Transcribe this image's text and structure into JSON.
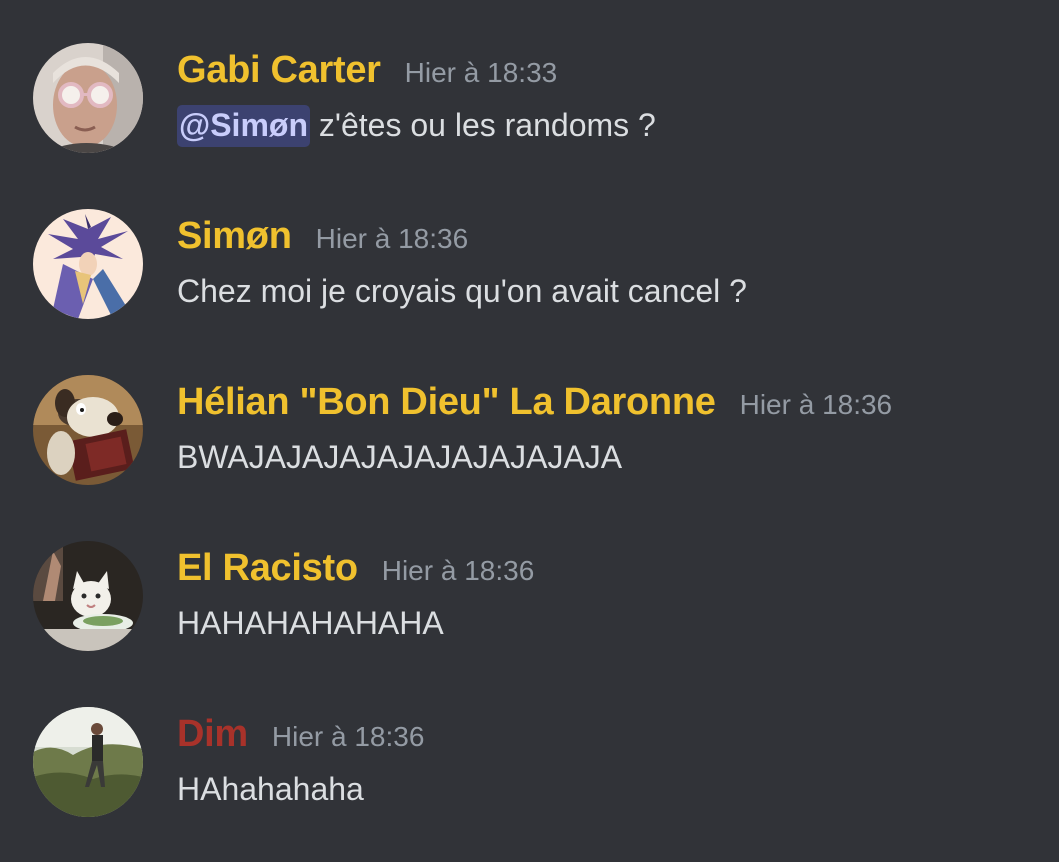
{
  "colors": {
    "background": "#313338",
    "author_gold": "#f0c12e",
    "author_red": "#a8322a",
    "timestamp": "#949ba4",
    "text": "#dbdee1",
    "mention_bg": "#3c4270",
    "mention_text": "#c9cdfb"
  },
  "messages": [
    {
      "author": "Gabi Carter",
      "author_color": "#f0c12e",
      "timestamp": "Hier à 18:33",
      "mention": "@Simøn",
      "text": " z'êtes ou les randoms ?",
      "avatar": "man-with-glasses-avatar"
    },
    {
      "author": "Simøn",
      "author_color": "#f0c12e",
      "timestamp": "Hier à 18:36",
      "text": "Chez moi je croyais qu'on avait cancel ?",
      "avatar": "anime-character-avatar"
    },
    {
      "author": "Hélian \"Bon Dieu\" La Daronne",
      "author_color": "#f0c12e",
      "timestamp": "Hier à 18:36",
      "text": "BWAJAJAJAJAJAJAJAJAJAJA",
      "avatar": "clay-dog-reading-avatar"
    },
    {
      "author": "El Racisto",
      "author_color": "#f0c12e",
      "timestamp": "Hier à 18:36",
      "text": "HAHAHAHAHAHA",
      "avatar": "cat-at-table-avatar"
    },
    {
      "author": "Dim",
      "author_color": "#a8322a",
      "timestamp": "Hier à 18:36",
      "text": "HAhahahaha",
      "avatar": "person-outdoors-avatar"
    }
  ]
}
